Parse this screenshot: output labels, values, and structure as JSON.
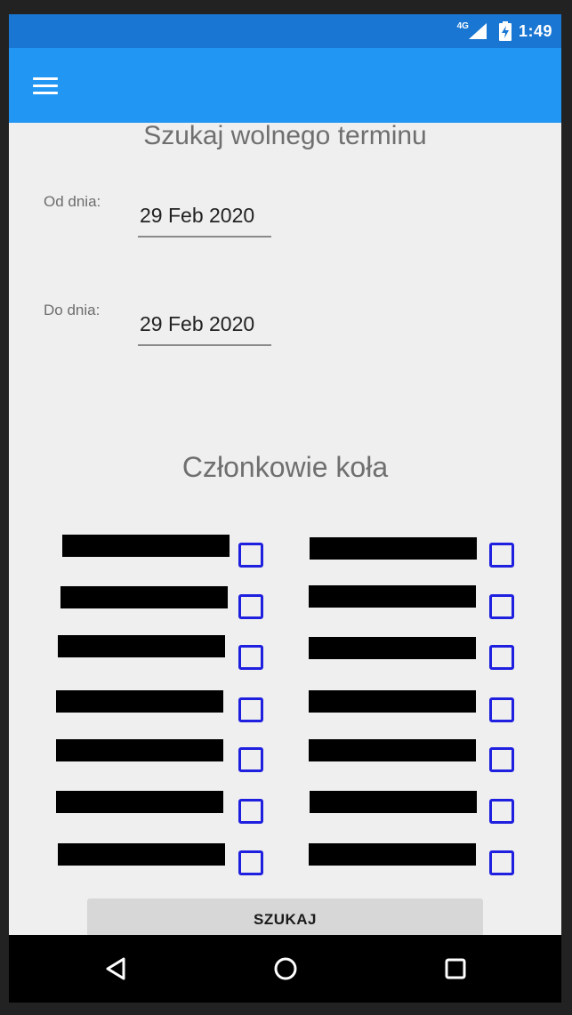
{
  "status_bar": {
    "network_label": "4G",
    "time": "1:49",
    "signal_icon": "signal-icon",
    "battery_icon": "battery-charging-icon",
    "background_color": "#1976d2"
  },
  "app_bar": {
    "menu_icon": "hamburger-menu-icon",
    "background_color": "#2196f3"
  },
  "search_form": {
    "title": "Szukaj wolnego terminu",
    "from_label": "Od dnia:",
    "from_value": "29 Feb 2020",
    "to_label": "Do dnia:",
    "to_value": "29 Feb 2020"
  },
  "members": {
    "title": "Członkowie koła",
    "left_column": [
      {
        "name_redacted": true,
        "checked": false
      },
      {
        "name_redacted": true,
        "checked": false
      },
      {
        "name_redacted": true,
        "checked": false
      },
      {
        "name_redacted": true,
        "checked": false
      },
      {
        "name_redacted": true,
        "checked": false
      },
      {
        "name_redacted": true,
        "checked": false
      },
      {
        "name_redacted": true,
        "checked": false
      }
    ],
    "right_column": [
      {
        "name_redacted": true,
        "checked": false
      },
      {
        "name_redacted": true,
        "checked": false
      },
      {
        "name_redacted": true,
        "checked": false
      },
      {
        "name_redacted": true,
        "checked": false
      },
      {
        "name_redacted": true,
        "checked": false
      },
      {
        "name_redacted": true,
        "checked": false
      },
      {
        "name_redacted": true,
        "checked": false
      }
    ],
    "checkbox_color": "#1f1fe0"
  },
  "actions": {
    "search_label": "SZUKAJ"
  },
  "nav_bar": {
    "back_icon": "back-triangle-icon",
    "home_icon": "home-circle-icon",
    "recents_icon": "recents-square-icon"
  }
}
